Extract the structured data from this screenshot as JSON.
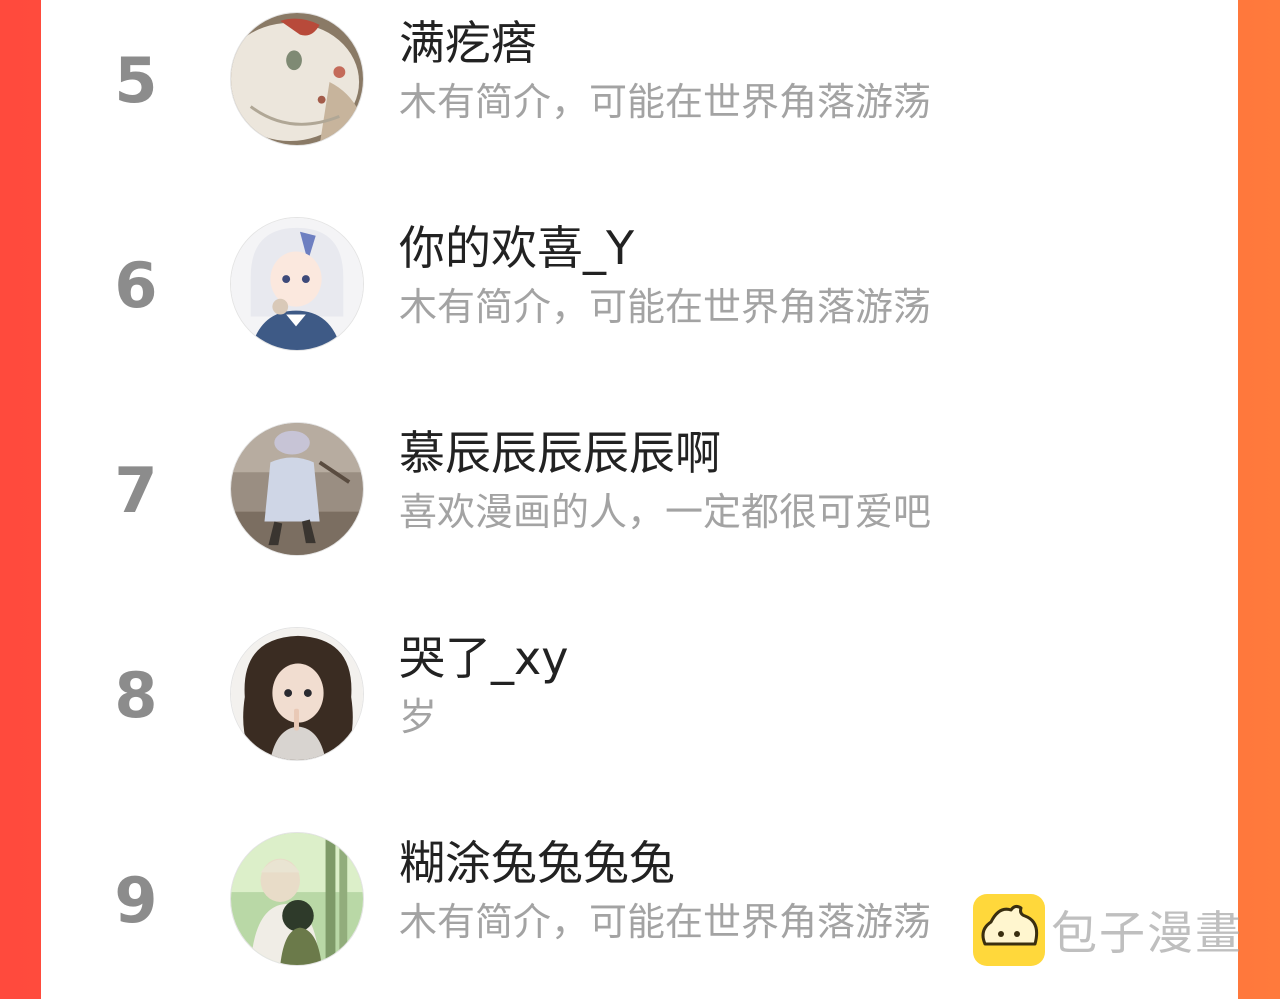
{
  "ranking": [
    {
      "rank": "5",
      "name": "满疙瘩",
      "bio": "木有简介，可能在世界角落游荡",
      "avatar": "avatar-plate-icon"
    },
    {
      "rank": "6",
      "name": "你的欢喜_Y",
      "bio": "木有简介，可能在世界角落游荡",
      "avatar": "avatar-anime-girl-icon"
    },
    {
      "rank": "7",
      "name": "慕辰辰辰辰辰啊",
      "bio": "喜欢漫画的人，一定都很可爱吧",
      "avatar": "avatar-child-photo-icon"
    },
    {
      "rank": "8",
      "name": "哭了_xy",
      "bio": "岁",
      "avatar": "avatar-curly-hair-girl-icon"
    },
    {
      "rank": "9",
      "name": "糊涂兔兔兔兔",
      "bio": "木有简介，可能在世界角落游荡",
      "avatar": "avatar-forest-couple-icon"
    }
  ],
  "watermark": {
    "text": "包子漫畫",
    "icon": "baozi-logo-icon"
  },
  "colors": {
    "background_left": "#ff4a3d",
    "background_right": "#ff7a3c",
    "panel": "#ffffff",
    "rank": "#8c8c8c",
    "name": "#222222",
    "bio": "#a3a3a3",
    "logo": "#ffd83b"
  }
}
